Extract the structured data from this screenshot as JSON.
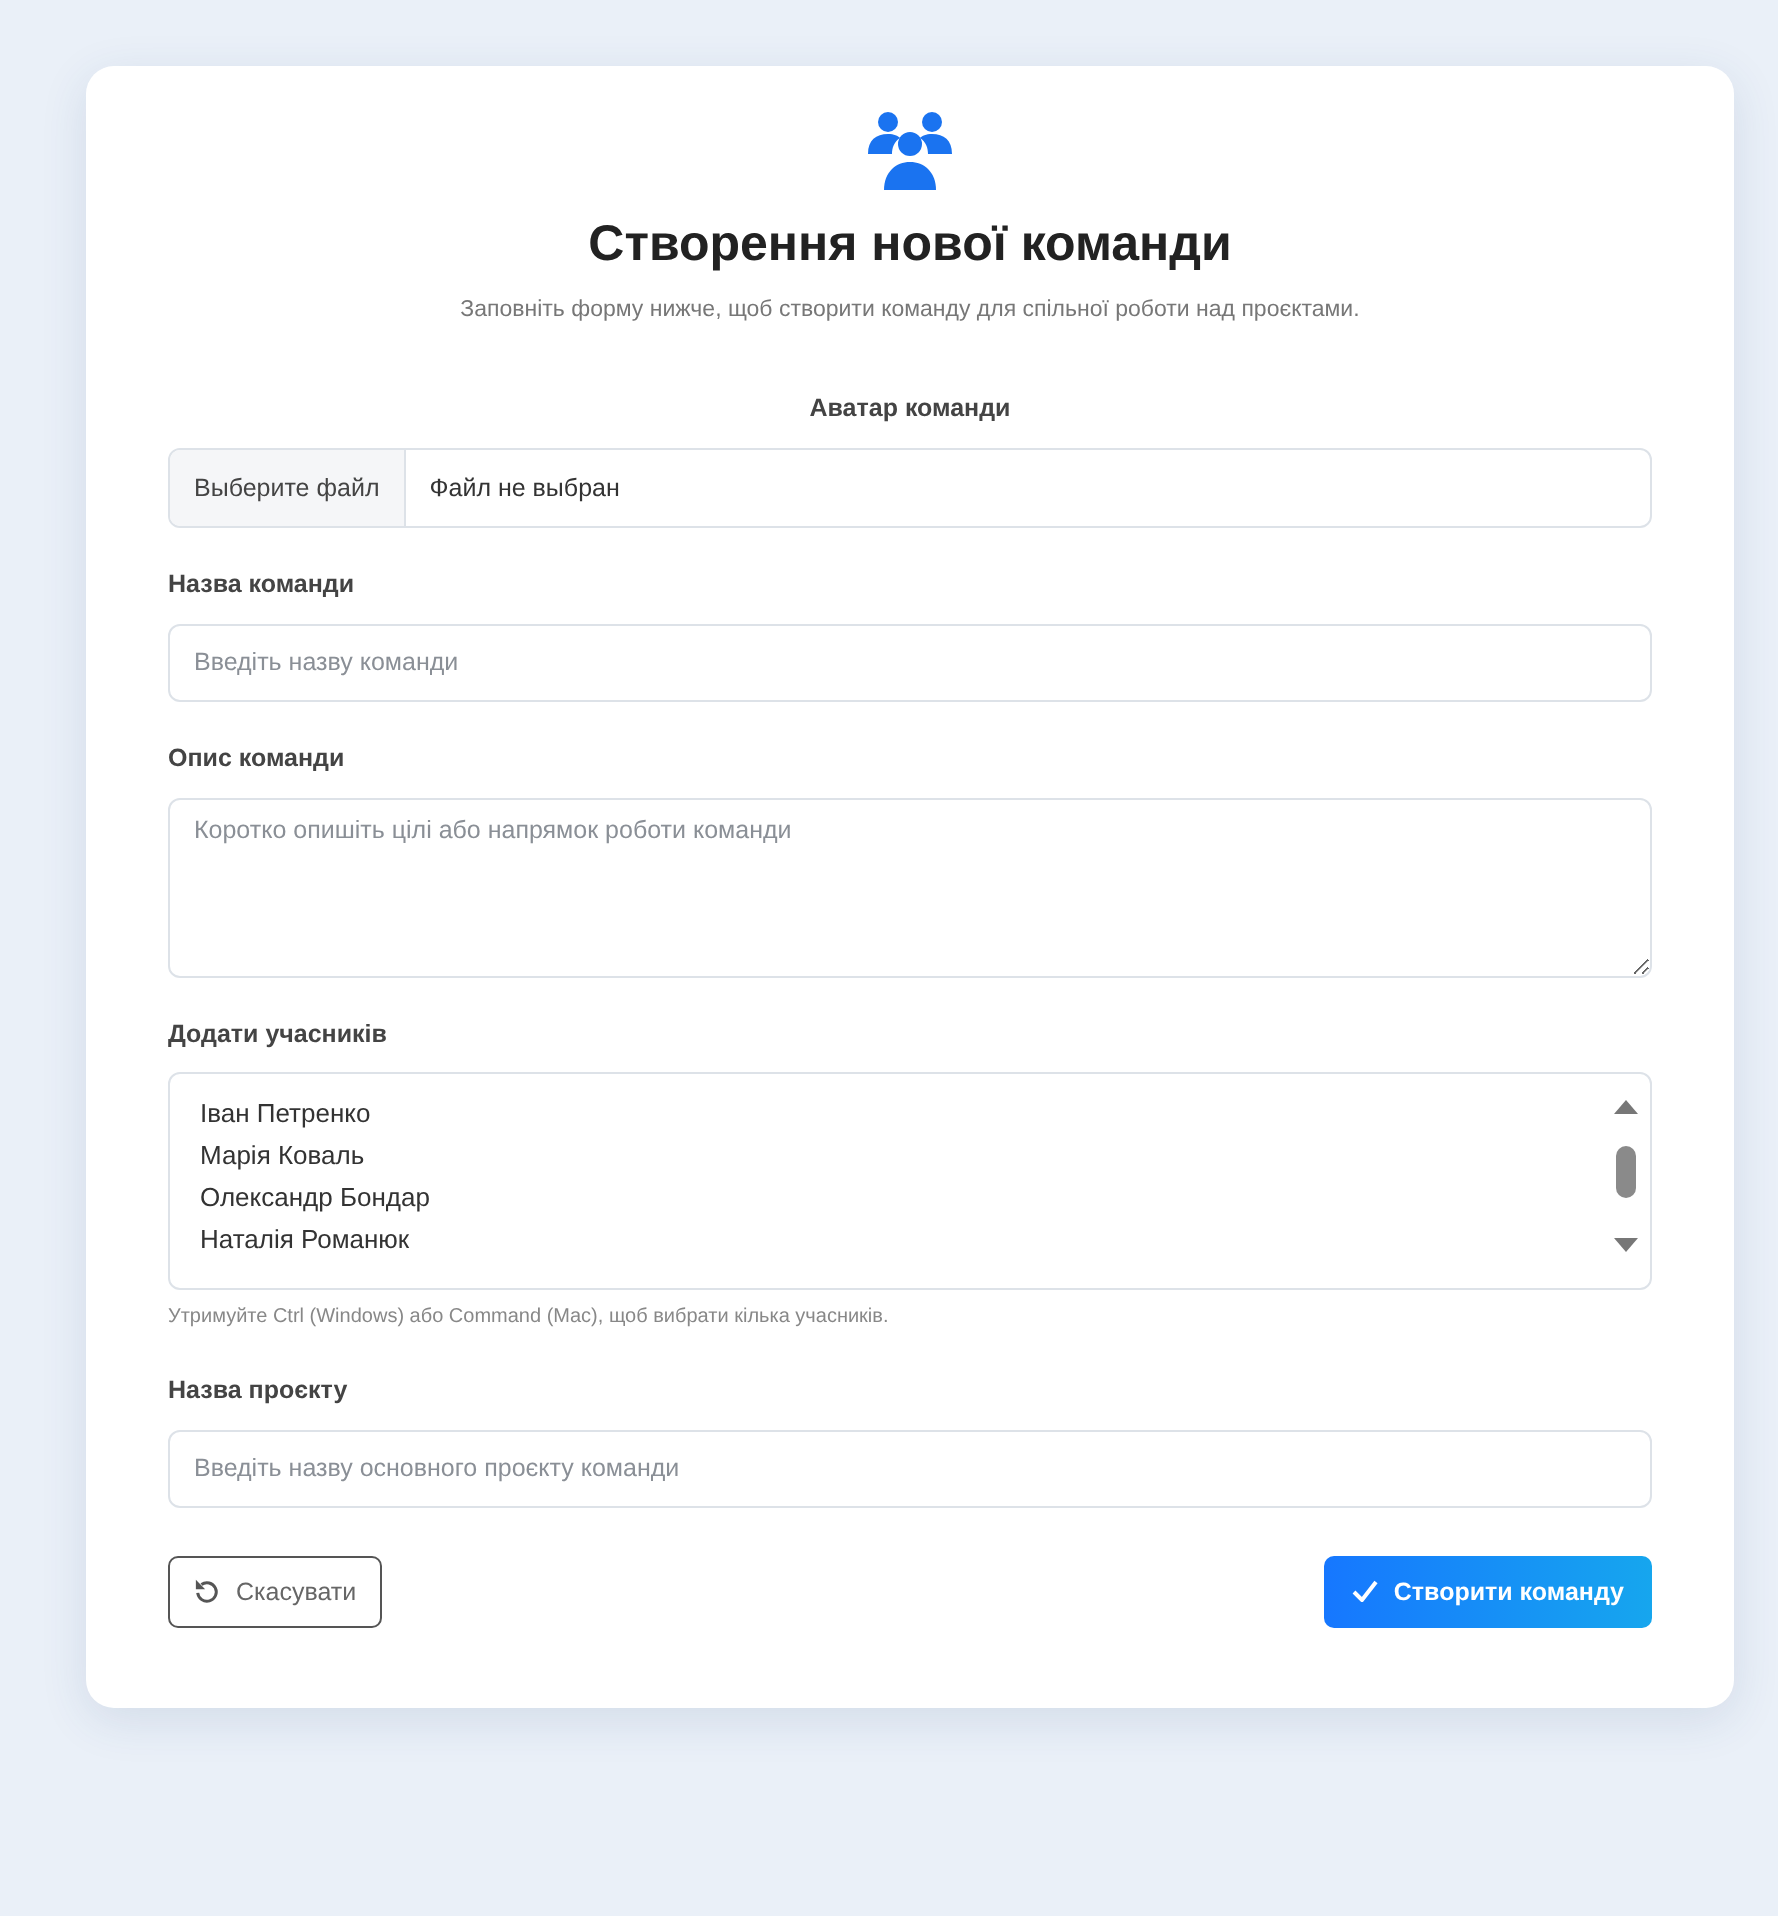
{
  "header": {
    "title": "Створення нової команди",
    "subtitle": "Заповніть форму нижче, щоб створити команду для спільної роботи над проєктами."
  },
  "fields": [
    {
      "kind": "file",
      "label": "Аватар команди",
      "button": "Выберите файл",
      "status": "Файл не выбран"
    },
    {
      "kind": "text",
      "label": "Назва команди",
      "placeholder": "Введіть назву команди"
    },
    {
      "kind": "textarea",
      "label": "Опис команди",
      "placeholder": "Коротко опишіть цілі або напрямок роботи команди"
    },
    {
      "kind": "listbox",
      "label": "Додати учасників",
      "options": [
        {
          "text": "Іван Петренко",
          "selected": false
        },
        {
          "text": "Марія Коваль",
          "selected": false
        },
        {
          "text": "Олександр Бондар",
          "selected": false
        },
        {
          "text": "Наталія Романюк",
          "selected": false
        }
      ],
      "help": "Утримуйте Ctrl (Windows) або Command (Mac), щоб вибрати кілька учасників."
    },
    {
      "kind": "text",
      "label": "Назва проєкту",
      "placeholder": "Введіть назву основного проєкту команди"
    }
  ],
  "buttons": [
    {
      "kind": "cancel",
      "label": "Скасувати"
    },
    {
      "kind": "submit",
      "label": "Створити команду"
    }
  ]
}
